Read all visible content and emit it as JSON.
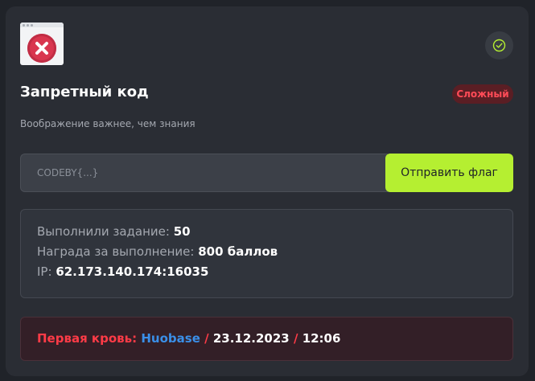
{
  "task": {
    "icon": "browser-error-icon",
    "status_icon": "check-circle-icon",
    "title": "Запретный код",
    "difficulty": "Сложный",
    "description": "Воображение важнее, чем знания"
  },
  "flag_form": {
    "placeholder": "CODEBY{...}",
    "value": "",
    "submit_label": "Отправить флаг"
  },
  "info": {
    "solved_label": "Выполнили задание:",
    "solved_value": "50",
    "reward_label": "Награда за выполнение:",
    "reward_value": "800 баллов",
    "ip_label": "IP:",
    "ip_value": "62.173.140.174:16035"
  },
  "first_blood": {
    "label": "Первая кровь:",
    "user": "Huobase",
    "separator": "/",
    "date": "23.12.2023",
    "time": "12:06"
  },
  "colors": {
    "accent": "#b5ef31",
    "danger": "#ff3b47",
    "link": "#3a8fe8",
    "card": "#2a2d34"
  }
}
